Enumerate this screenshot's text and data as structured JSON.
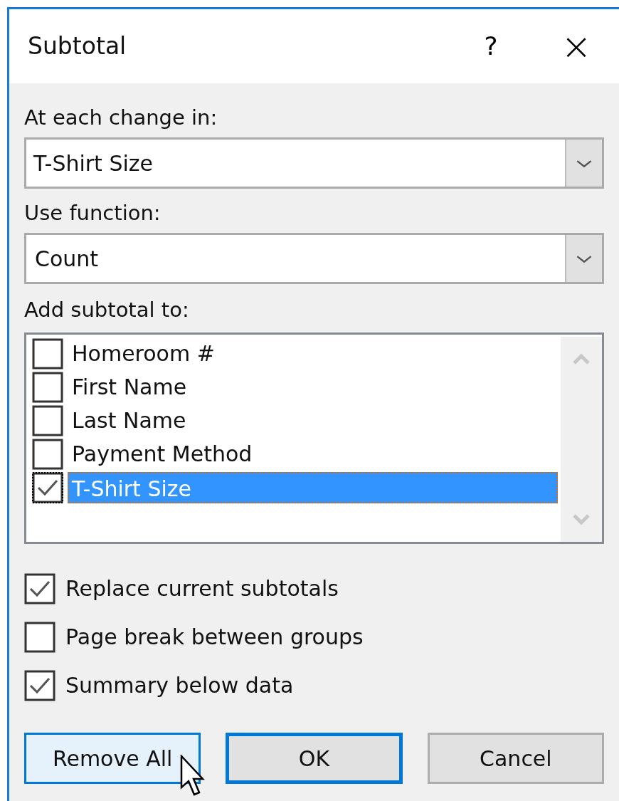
{
  "window": {
    "title": "Subtotal",
    "help": "?",
    "close": "×"
  },
  "change_field": {
    "label": "At each change in:",
    "value": "T-Shirt Size"
  },
  "function_field": {
    "label": "Use function:",
    "value": "Count"
  },
  "subtotal_list": {
    "label": "Add subtotal to:",
    "items": [
      {
        "label": "Homeroom #",
        "checked": false,
        "selected": false
      },
      {
        "label": "First Name",
        "checked": false,
        "selected": false
      },
      {
        "label": "Last Name",
        "checked": false,
        "selected": false
      },
      {
        "label": "Payment Method",
        "checked": false,
        "selected": false
      },
      {
        "label": "T-Shirt Size",
        "checked": true,
        "selected": true
      }
    ]
  },
  "options": [
    {
      "label": "Replace current subtotals",
      "checked": true
    },
    {
      "label": "Page break between groups",
      "checked": false
    },
    {
      "label": "Summary below data",
      "checked": true
    }
  ],
  "buttons": [
    {
      "label": "Remove All",
      "hovered": true,
      "default": false
    },
    {
      "label": "OK",
      "hovered": false,
      "default": true
    },
    {
      "label": "Cancel",
      "hovered": false,
      "default": false
    }
  ]
}
